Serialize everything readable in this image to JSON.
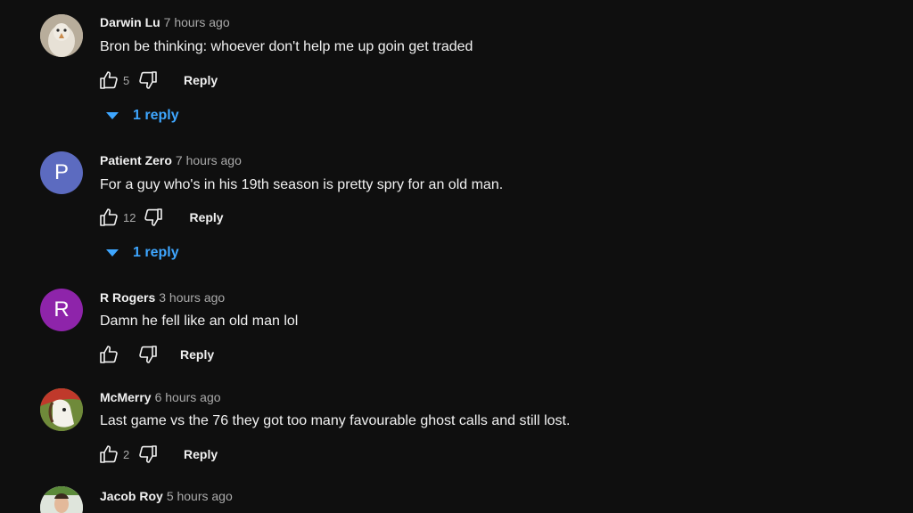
{
  "colors": {
    "background": "#0f0f0f",
    "text": "#f1f1f1",
    "secondary": "#aaaaaa",
    "link": "#3ea6ff",
    "avatar_p": "#5c6bc0",
    "avatar_r": "#8e24aa"
  },
  "comments": [
    {
      "author": "Darwin Lu",
      "time": "7 hours ago",
      "text": "Bron be thinking: whoever don't help me up goin get traded",
      "likes": "5",
      "reply_label": "Reply",
      "replies_label": "1 reply",
      "avatar_icon": "bird-photo-avatar"
    },
    {
      "author": "Patient Zero",
      "time": "7 hours ago",
      "text": "For a guy who's in his 19th season is pretty spry for an old man.",
      "likes": "12",
      "reply_label": "Reply",
      "replies_label": "1 reply",
      "avatar_letter": "P"
    },
    {
      "author": "R Rogers",
      "time": "3 hours ago",
      "text": "Damn he fell like an old man lol",
      "likes": "",
      "reply_label": "Reply",
      "avatar_letter": "R"
    },
    {
      "author": "McMerry",
      "time": "6 hours ago",
      "text": "Last game vs the 76 they got too many favourable ghost calls and still lost.",
      "likes": "2",
      "reply_label": "Reply",
      "avatar_icon": "cartoon-horse-avatar"
    },
    {
      "author": "Jacob Roy",
      "time": "5 hours ago",
      "avatar_icon": "person-photo-avatar"
    }
  ]
}
